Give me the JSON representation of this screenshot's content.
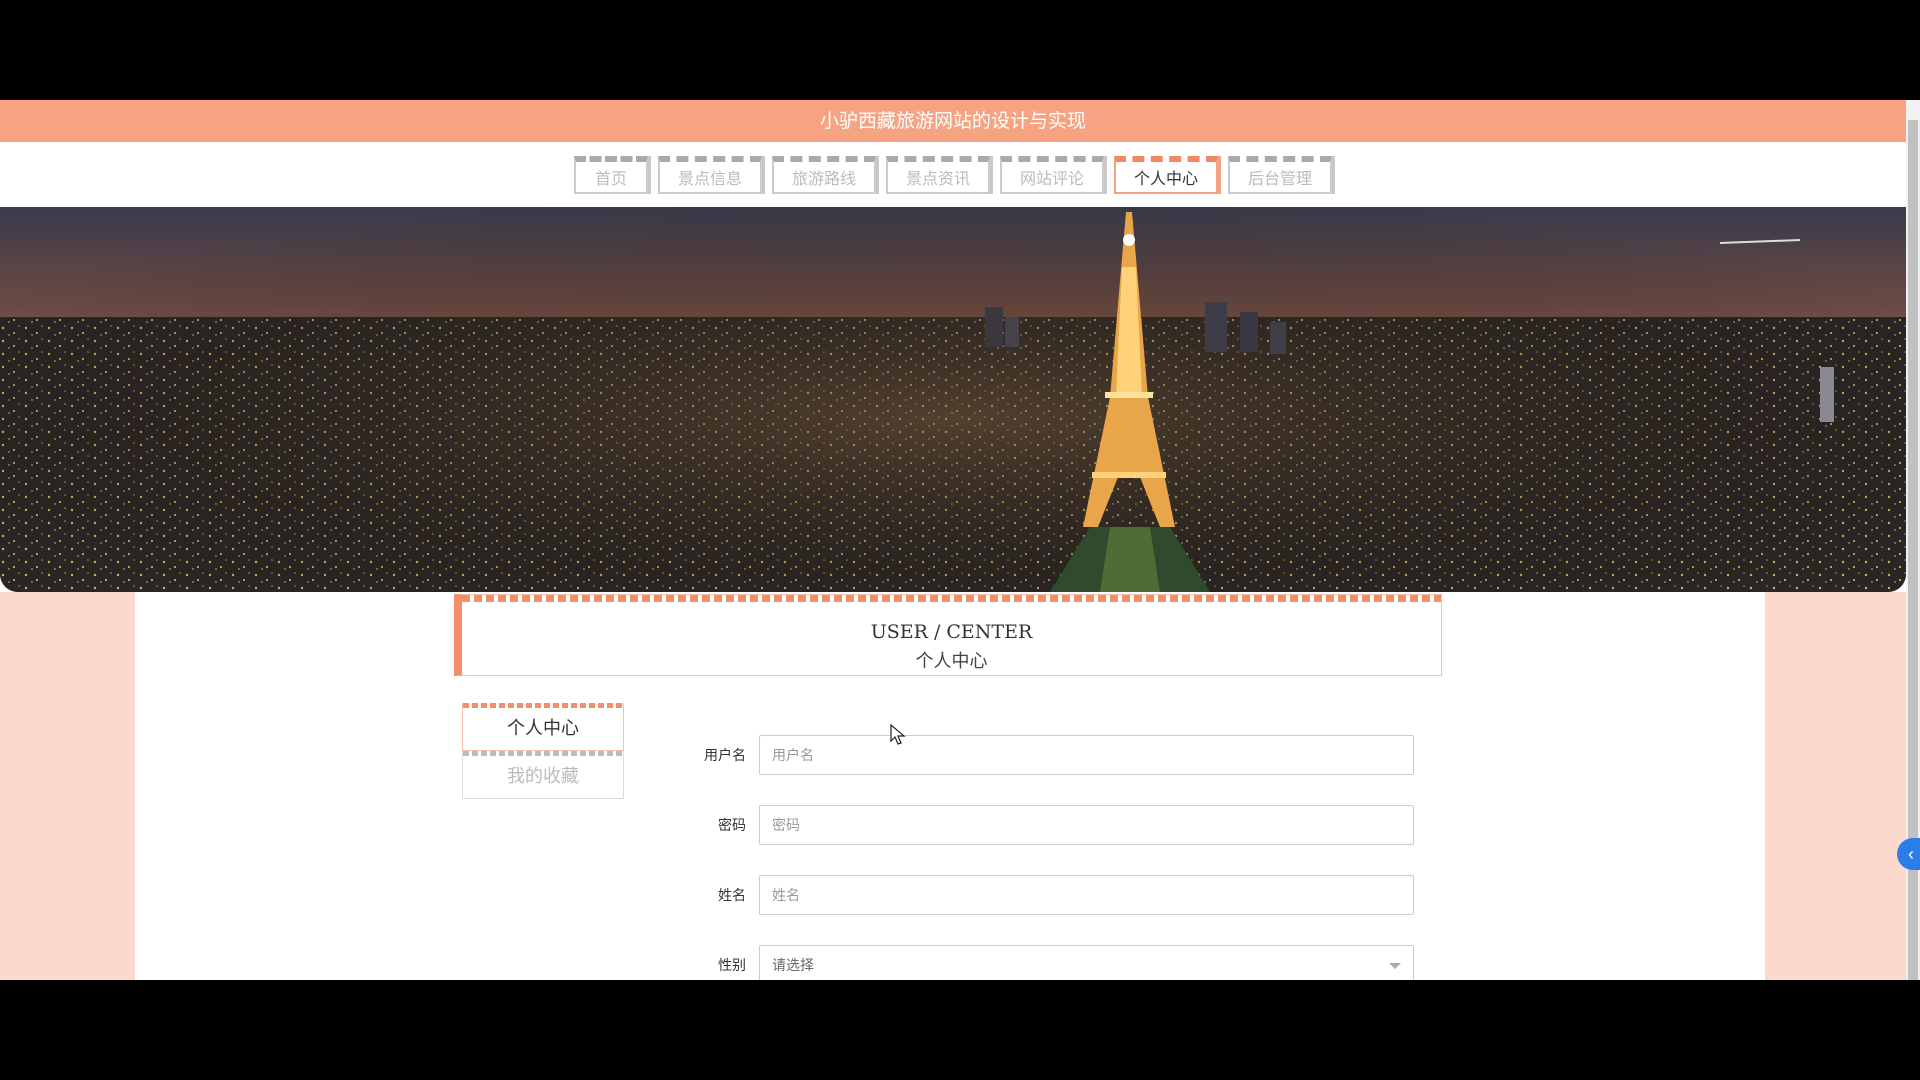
{
  "site": {
    "title": "小驴西藏旅游网站的设计与实现"
  },
  "nav": {
    "items": [
      {
        "label": "首页",
        "active": false
      },
      {
        "label": "景点信息",
        "active": false
      },
      {
        "label": "旅游路线",
        "active": false
      },
      {
        "label": "景点资讯",
        "active": false
      },
      {
        "label": "网站评论",
        "active": false
      },
      {
        "label": "个人中心",
        "active": true
      },
      {
        "label": "后台管理",
        "active": false
      }
    ]
  },
  "section": {
    "title_en": "USER / CENTER",
    "title_cn": "个人中心"
  },
  "sidebar": {
    "items": [
      {
        "label": "个人中心",
        "active": true
      },
      {
        "label": "我的收藏",
        "active": false
      }
    ]
  },
  "form": {
    "username": {
      "label": "用户名",
      "placeholder": "用户名",
      "value": ""
    },
    "password": {
      "label": "密码",
      "placeholder": "密码",
      "value": ""
    },
    "name": {
      "label": "姓名",
      "placeholder": "姓名",
      "value": ""
    },
    "gender": {
      "label": "性别",
      "selected": "请选择"
    }
  },
  "colors": {
    "brand": "#f7a382",
    "accent": "#f38e6a",
    "side_panel": "#fbd9cd",
    "toggle": "#2b7de9"
  },
  "icons": {
    "side_toggle": "chevron-left-icon",
    "select_caret": "caret-down-icon",
    "cursor": "mouse-pointer-icon"
  }
}
